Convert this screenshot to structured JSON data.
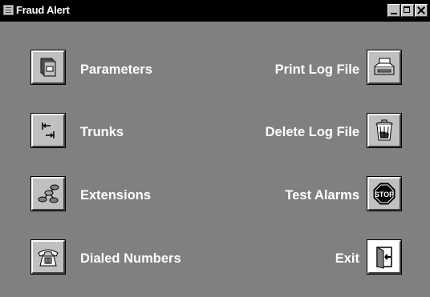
{
  "window": {
    "title": "Fraud Alert"
  },
  "left_items": [
    {
      "label": "Parameters",
      "icon": "parameters-icon"
    },
    {
      "label": "Trunks",
      "icon": "trunks-icon"
    },
    {
      "label": "Extensions",
      "icon": "extensions-icon"
    },
    {
      "label": "Dialed Numbers",
      "icon": "telephone-icon"
    }
  ],
  "right_items": [
    {
      "label": "Print Log File",
      "icon": "printer-icon"
    },
    {
      "label": "Delete Log File",
      "icon": "trash-can-icon"
    },
    {
      "label": "Test Alarms",
      "icon": "stop-sign-icon",
      "icon_text": "STOP"
    },
    {
      "label": "Exit",
      "icon": "exit-door-icon"
    }
  ],
  "colors": {
    "background": "#808080",
    "titlebar": "#000000",
    "text": "#ffffff",
    "button": "#c0c0c0",
    "stop": "#000000"
  }
}
